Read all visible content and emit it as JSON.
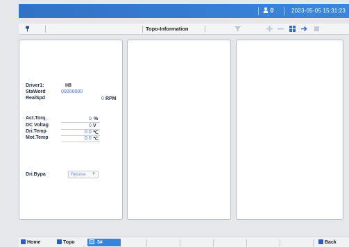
{
  "header": {
    "user_label": "0",
    "datetime": "2023-05-05 15:31:23"
  },
  "toolbar": {
    "title": "Topo-Information"
  },
  "left_panel": {
    "rows": [
      {
        "label": "Driver1:",
        "value": "H8",
        "unit": ""
      },
      {
        "label": "StaWord",
        "value": "00000000",
        "unit": ""
      },
      {
        "label": "RealSpd",
        "value": "0",
        "unit": "RPM"
      },
      {
        "label": "Act.Torq.",
        "value": "0",
        "unit": "%"
      },
      {
        "label": "DC Voltag",
        "value": "0",
        "unit": "V"
      },
      {
        "label": "Dri.Temp",
        "value": "0.0",
        "unit": "℃"
      },
      {
        "label": "Mot.Temp",
        "value": "0.0",
        "unit": "℃"
      }
    ],
    "bypass": {
      "label": "Dri.Bypa",
      "selected": "Relulse"
    }
  },
  "bottom_nav": {
    "home": "Home",
    "topo": "Topo",
    "active": "3#",
    "back": "Back"
  }
}
